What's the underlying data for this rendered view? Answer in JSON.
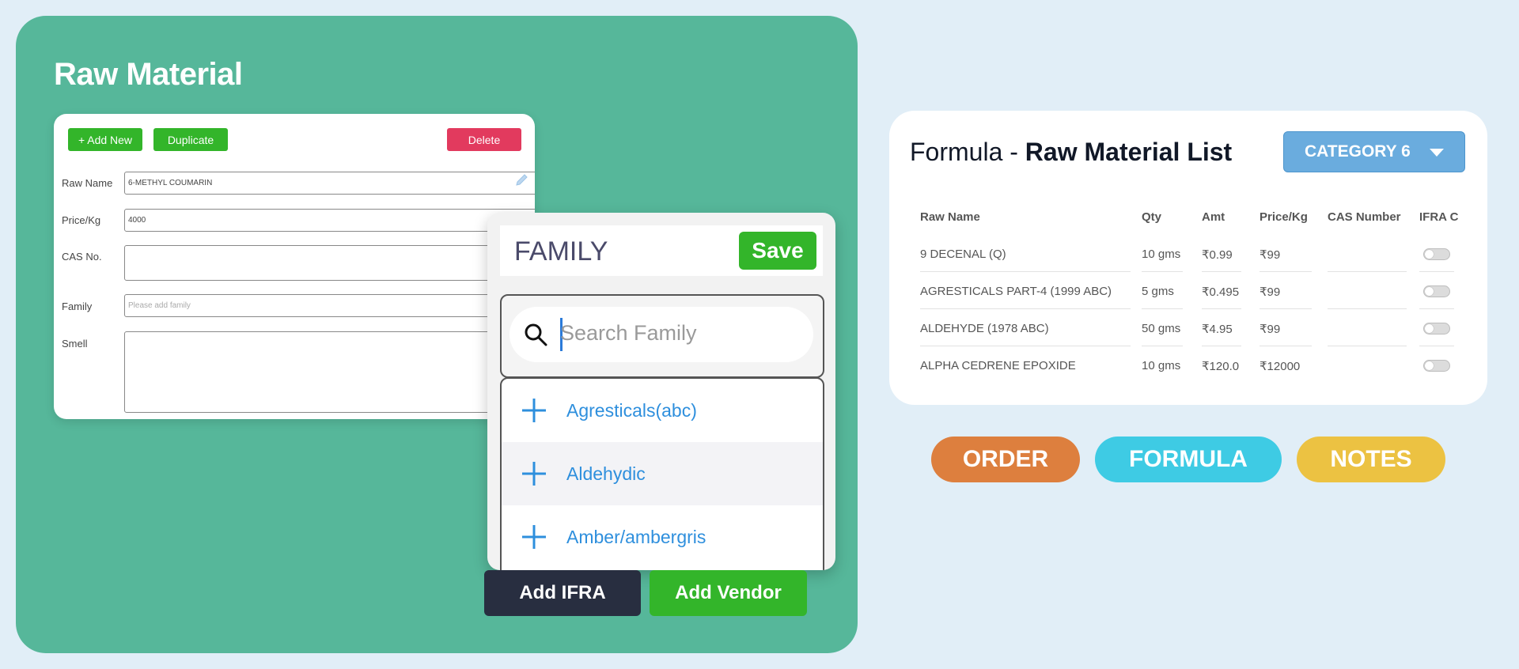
{
  "raw_material": {
    "title": "Raw Material",
    "buttons": {
      "add_new": "+ Add New",
      "duplicate": "Duplicate",
      "delete": "Delete"
    },
    "fields": {
      "raw_name": {
        "label": "Raw Name",
        "value": "6-METHYL COUMARIN"
      },
      "price": {
        "label": "Price/Kg",
        "value": "4000"
      },
      "cas": {
        "label": "CAS No.",
        "value": ""
      },
      "family": {
        "label": "Family",
        "placeholder": "Please add family"
      },
      "smell": {
        "label": "Smell",
        "value": ""
      }
    },
    "actions": {
      "add_ifra": "Add IFRA",
      "add_vendor": "Add Vendor"
    }
  },
  "family_popup": {
    "title": "FAMILY",
    "save": "Save",
    "search_placeholder": "Search Family",
    "items": [
      {
        "label": "Agresticals(abc)"
      },
      {
        "label": "Aldehydic"
      },
      {
        "label": "Amber/ambergris"
      }
    ]
  },
  "formula": {
    "title_prefix": "Formula - ",
    "title_bold": "Raw Material List",
    "category": "CATEGORY 6",
    "columns": [
      "Raw Name",
      "Qty",
      "Amt",
      "Price/Kg",
      "CAS Number",
      "IFRA C"
    ],
    "rows": [
      {
        "name": "9 DECENAL (Q)",
        "qty": "10 gms",
        "amt": "₹0.99",
        "price": "₹99",
        "cas": "",
        "ifra": false
      },
      {
        "name": "AGRESTICALS PART-4 (1999 ABC)",
        "qty": "5 gms",
        "amt": "₹0.495",
        "price": "₹99",
        "cas": "",
        "ifra": false
      },
      {
        "name": "ALDEHYDE (1978 ABC)",
        "qty": "50 gms",
        "amt": "₹4.95",
        "price": "₹99",
        "cas": "",
        "ifra": false
      },
      {
        "name": "ALPHA CEDRENE EPOXIDE",
        "qty": "10 gms",
        "amt": "₹120.0",
        "price": "₹12000",
        "cas": "",
        "ifra": false
      }
    ]
  },
  "pills": {
    "order": "ORDER",
    "formula": "FORMULA",
    "notes": "NOTES"
  },
  "colors": {
    "background": "#e1eef7",
    "panel": "#56b79a",
    "green_button": "#33b52a",
    "delete_button": "#e23a5e",
    "dark_button": "#282e40",
    "category_button": "#6aacde",
    "link_blue": "#2e8fdd",
    "order": "#dd7f3e",
    "formula": "#3ecbe4",
    "notes": "#ecc242"
  },
  "icons": [
    "pencil-icon",
    "search-icon",
    "plus-icon",
    "chevron-down-icon"
  ]
}
